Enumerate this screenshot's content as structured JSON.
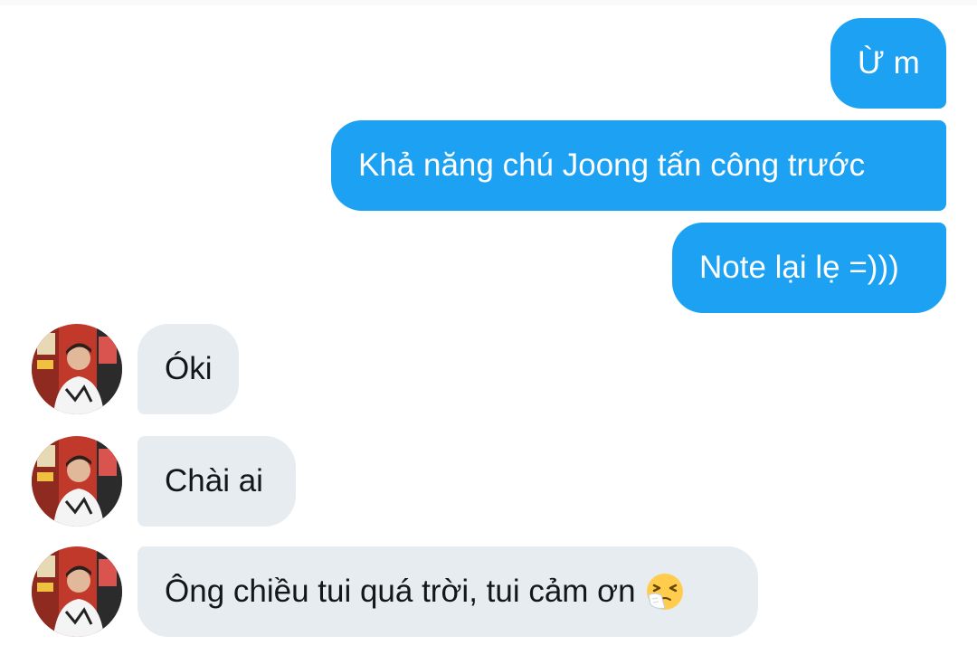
{
  "conversation": {
    "messages": [
      {
        "sender": "me",
        "text": "Ừ m"
      },
      {
        "sender": "me",
        "text": "Khả năng chú Joong tấn công trước"
      },
      {
        "sender": "me",
        "text": "Note lại lẹ =)))"
      },
      {
        "sender": "other",
        "text": "Óki"
      },
      {
        "sender": "other",
        "text": "Chài ai"
      },
      {
        "sender": "other",
        "text": "Ông chiều tui quá trời, tui cảm ơn",
        "emoji": "sneezing-face-icon"
      }
    ]
  },
  "colors": {
    "sent_bubble": "#1da1f2",
    "received_bubble": "#e6ecf0",
    "sent_text": "#ffffff",
    "received_text": "#14171a"
  }
}
